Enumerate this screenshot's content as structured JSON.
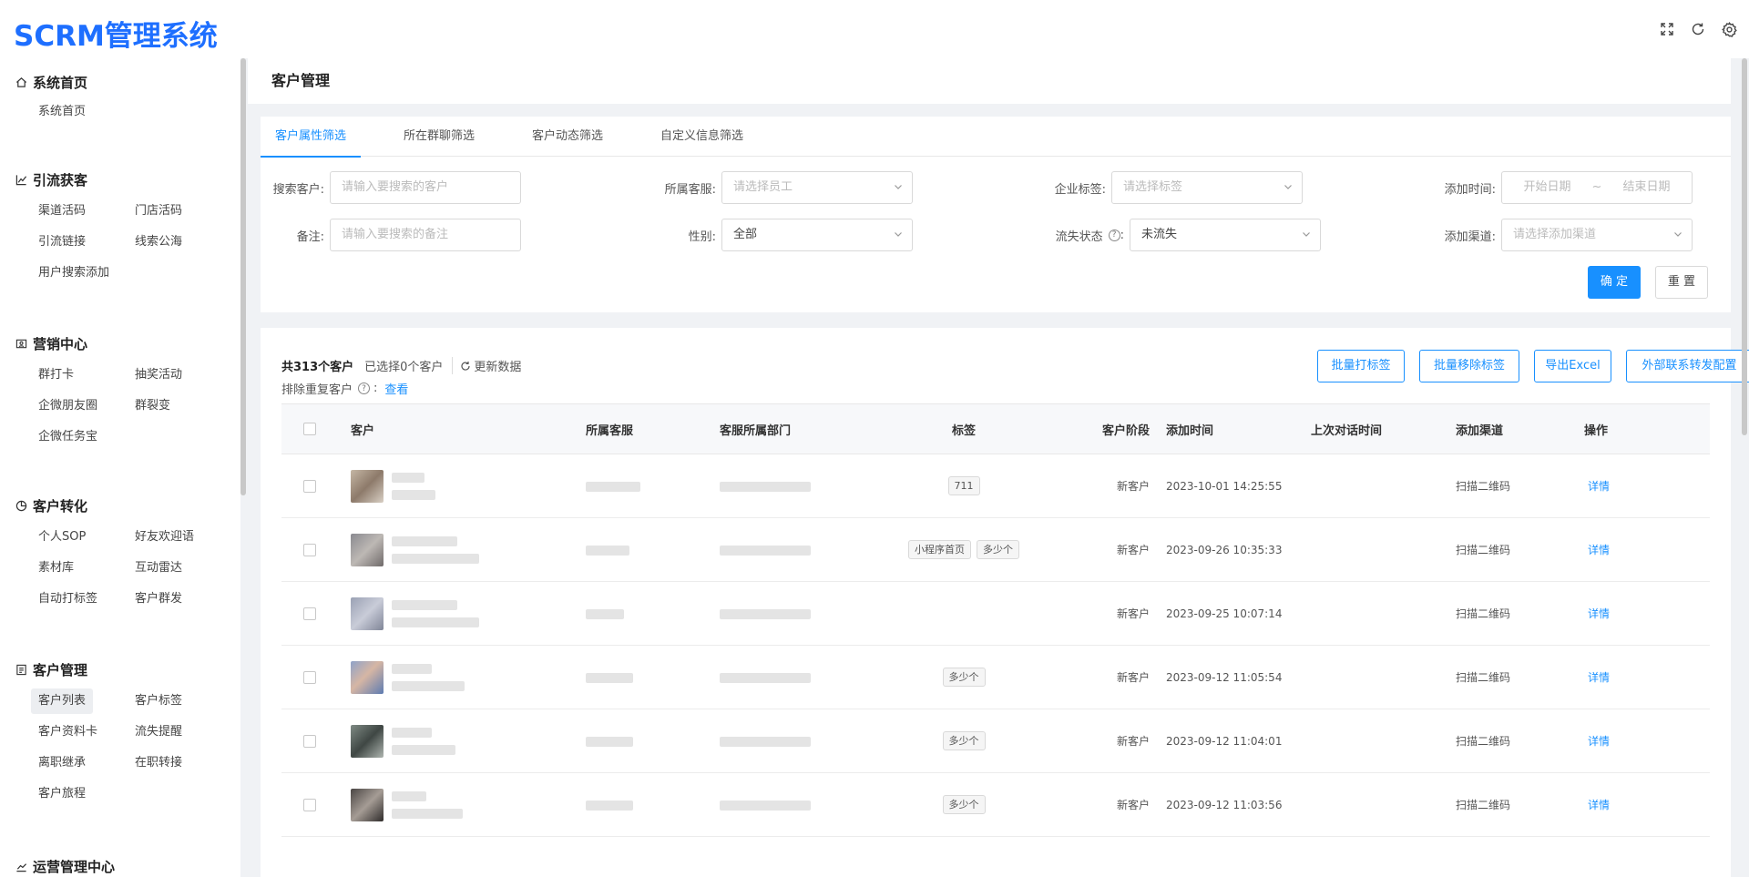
{
  "app": {
    "brand": "SCRM管理系统"
  },
  "sidebar": {
    "groups": [
      {
        "title": "系统首页",
        "icon": "home-icon",
        "items": [
          "系统首页"
        ]
      },
      {
        "title": "引流获客",
        "icon": "chart-line-icon",
        "items": [
          "渠道活码",
          "门店活码",
          "引流链接",
          "线索公海",
          "用户搜索添加"
        ]
      },
      {
        "title": "营销中心",
        "icon": "id-card-icon",
        "items": [
          "群打卡",
          "抽奖活动",
          "企微朋友圈",
          "群裂变",
          "企微任务宝"
        ]
      },
      {
        "title": "客户转化",
        "icon": "pie-chart-icon",
        "items": [
          "个人SOP",
          "好友欢迎语",
          "素材库",
          "互动雷达",
          "自动打标签",
          "客户群发"
        ]
      },
      {
        "title": "客户管理",
        "icon": "document-icon",
        "items": [
          "客户列表",
          "客户标签",
          "客户资料卡",
          "流失提醒",
          "离职继承",
          "在职转接",
          "客户旅程"
        ],
        "active": "客户列表"
      },
      {
        "title": "运营管理中心",
        "icon": "trend-icon",
        "items": []
      }
    ]
  },
  "page": {
    "title": "客户管理"
  },
  "filters": {
    "tabs": [
      "客户属性筛选",
      "所在群聊筛选",
      "客户动态筛选",
      "自定义信息筛选"
    ],
    "active_tab": "客户属性筛选",
    "search_label": "搜索客户:",
    "search_placeholder": "请输入要搜索的客户",
    "staff_label": "所属客服:",
    "staff_placeholder": "请选择员工",
    "tag_label": "企业标签:",
    "tag_placeholder": "请选择标签",
    "date_label": "添加时间:",
    "date_start": "开始日期",
    "date_sep": "~",
    "date_end": "结束日期",
    "remark_label": "备注:",
    "remark_placeholder": "请输入要搜索的备注",
    "gender_label": "性别:",
    "gender_value": "全部",
    "churn_label": "流失状态",
    "churn_colon": ":",
    "churn_value": "未流失",
    "channel_label": "添加渠道:",
    "channel_placeholder": "请选择添加渠道",
    "confirm": "确 定",
    "reset": "重 置"
  },
  "list": {
    "total_text": "共313个客户",
    "selected_text": "已选择0个客户",
    "refresh_text": "更新数据",
    "dedup_text": "排除重复客户",
    "dedup_colon": ":",
    "dedup_link": "查看",
    "actions": [
      "批量打标签",
      "批量移除标签",
      "导出Excel",
      "外部联系转发配置"
    ],
    "columns": [
      "客户",
      "所属客服",
      "客服所属部门",
      "标签",
      "客户阶段",
      "添加时间",
      "上次对话时间",
      "添加渠道",
      "操作"
    ],
    "rows": [
      {
        "tags": [
          "711"
        ],
        "stage": "新客户",
        "added": "2023-10-01 14:25:55",
        "last": "",
        "channel": "扫描二维码",
        "op": "详情"
      },
      {
        "tags": [
          "小程序首页",
          "多少个"
        ],
        "stage": "新客户",
        "added": "2023-09-26 10:35:33",
        "last": "",
        "channel": "扫描二维码",
        "op": "详情"
      },
      {
        "tags": [],
        "stage": "新客户",
        "added": "2023-09-25 10:07:14",
        "last": "",
        "channel": "扫描二维码",
        "op": "详情"
      },
      {
        "tags": [
          "多少个"
        ],
        "stage": "新客户",
        "added": "2023-09-12 11:05:54",
        "last": "",
        "channel": "扫描二维码",
        "op": "详情"
      },
      {
        "tags": [
          "多少个"
        ],
        "stage": "新客户",
        "added": "2023-09-12 11:04:01",
        "last": "",
        "channel": "扫描二维码",
        "op": "详情"
      },
      {
        "tags": [
          "多少个"
        ],
        "stage": "新客户",
        "added": "2023-09-12 11:03:56",
        "last": "",
        "channel": "扫描二维码",
        "op": "详情"
      }
    ]
  },
  "colors": {
    "primary": "#1890ff",
    "brand": "#1e6fff"
  }
}
